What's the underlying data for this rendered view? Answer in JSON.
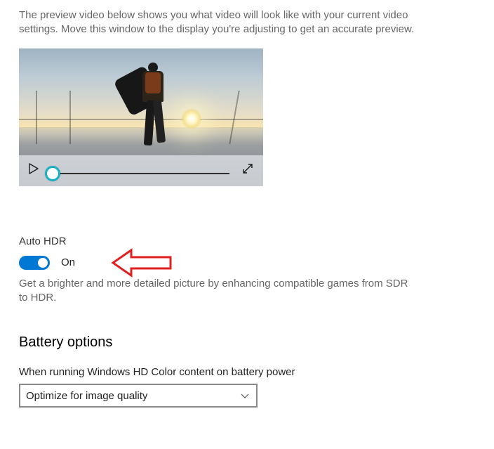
{
  "preview": {
    "description": "The preview video below shows you what video will look like with your current video settings. Move this window to the display you're adjusting to get an accurate preview."
  },
  "autoHdr": {
    "title": "Auto HDR",
    "state": "On",
    "description": "Get a brighter and more detailed picture by enhancing compatible games from SDR to HDR."
  },
  "battery": {
    "heading": "Battery options",
    "fieldLabel": "When running Windows HD Color content on battery power",
    "selected": "Optimize for image quality"
  }
}
